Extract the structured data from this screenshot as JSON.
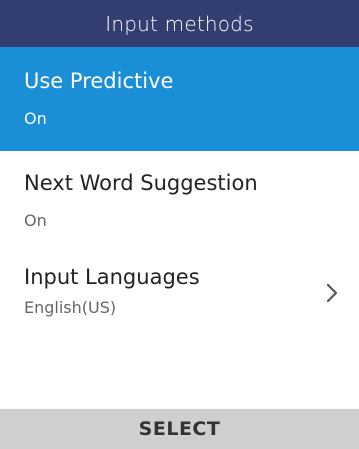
{
  "header": {
    "title": "Input methods"
  },
  "items": [
    {
      "label": "Use Predictive",
      "value": "On"
    },
    {
      "label": "Next Word Suggestion",
      "value": "On"
    },
    {
      "label": "Input Languages",
      "value": "English(US)"
    }
  ],
  "softkey": {
    "center_label": "SELECT"
  },
  "colors": {
    "header_bg": "#323e70",
    "selected_bg": "#1a8fd7",
    "softkey_bg": "#cfcfcf"
  },
  "icons": {
    "more": "chevron-right-icon"
  }
}
